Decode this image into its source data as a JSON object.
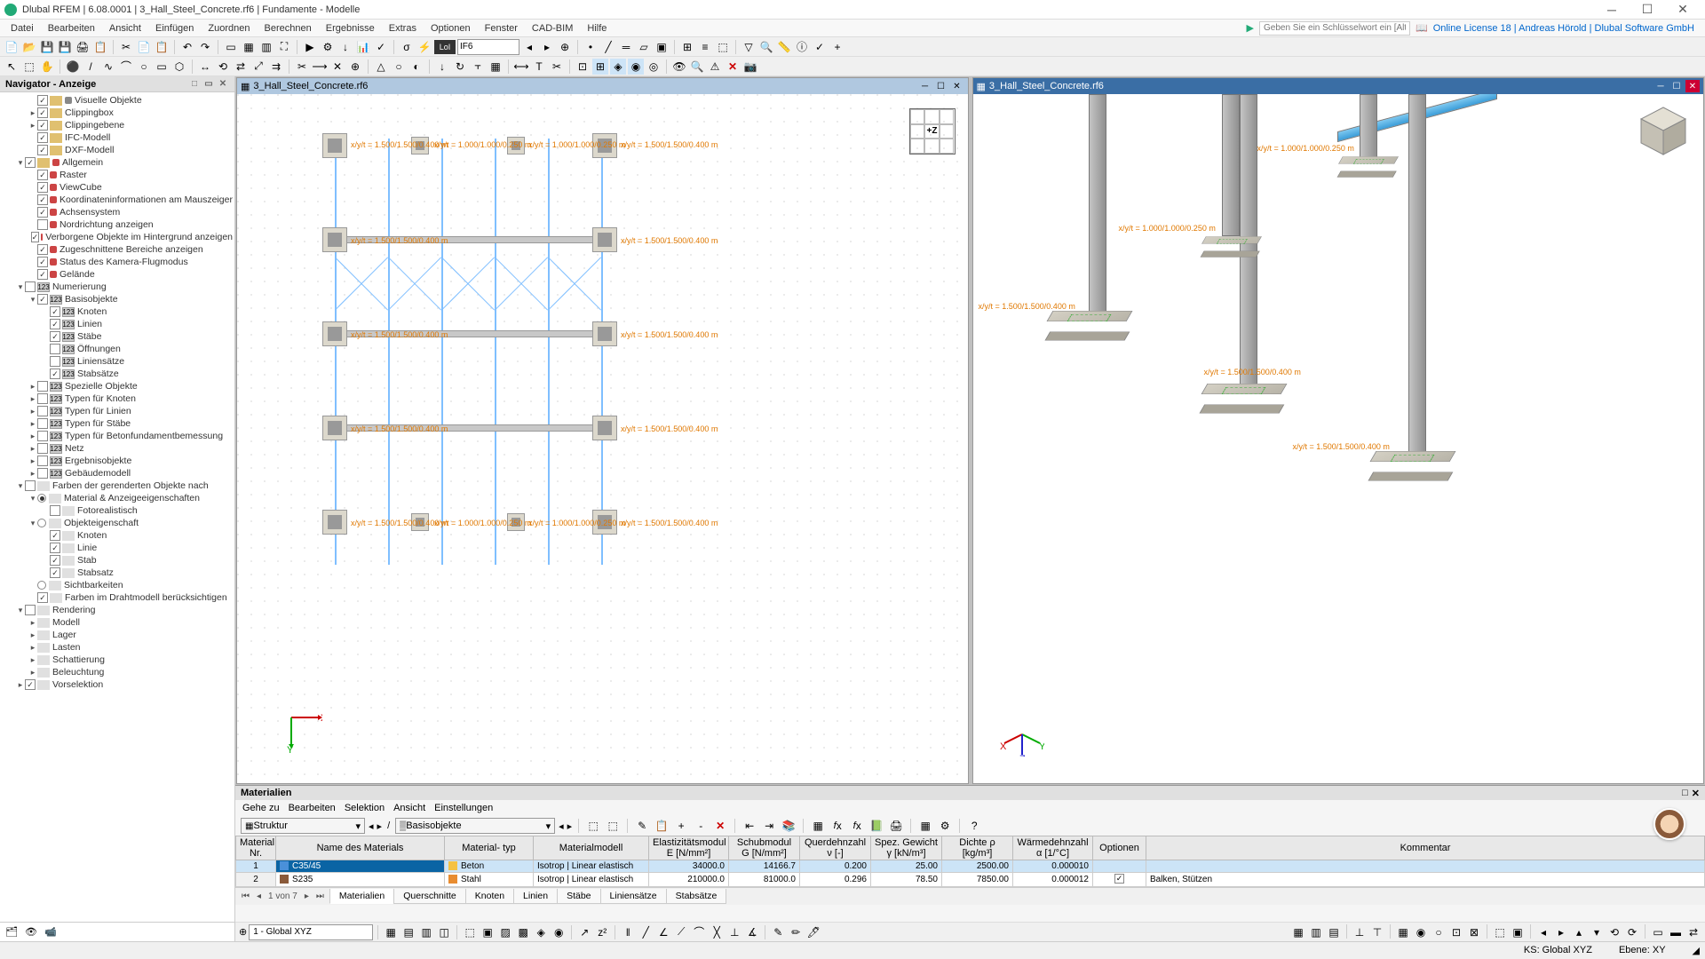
{
  "title": "Dlubal RFEM | 6.08.0001 | 3_Hall_Steel_Concrete.rf6 | Fundamente - Modelle",
  "menu": [
    "Datei",
    "Bearbeiten",
    "Ansicht",
    "Einfügen",
    "Zuordnen",
    "Berechnen",
    "Ergebnisse",
    "Extras",
    "Optionen",
    "Fenster",
    "CAD-BIM",
    "Hilfe"
  ],
  "key_placeholder": "Geben Sie ein Schlüsselwort ein [Alt...",
  "online": "Online License 18 | Andreas Hörold | Dlubal Software GmbH",
  "toolbar_combo": "IF6",
  "toolbar_badge": "LoI",
  "navigator": {
    "title": "Navigator - Anzeige",
    "items": [
      {
        "lvl": 2,
        "chk": true,
        "ico": "folder",
        "dotc": "#888",
        "label": "Visuelle Objekte"
      },
      {
        "lvl": 2,
        "toggle": "▸",
        "chk": true,
        "ico": "folder",
        "label": "Clippingbox"
      },
      {
        "lvl": 2,
        "toggle": "▸",
        "chk": true,
        "ico": "folder",
        "label": "Clippingebene"
      },
      {
        "lvl": 2,
        "chk": true,
        "ico": "folder",
        "label": "IFC-Modell"
      },
      {
        "lvl": 2,
        "chk": true,
        "ico": "folder",
        "label": "DXF-Modell"
      },
      {
        "lvl": 1,
        "toggle": "▾",
        "chk": true,
        "ico": "folder",
        "dotc": "#cc4444",
        "label": "Allgemein"
      },
      {
        "lvl": 2,
        "chk": true,
        "dotc": "#cc4444",
        "label": "Raster"
      },
      {
        "lvl": 2,
        "chk": true,
        "dotc": "#cc4444",
        "label": "ViewCube"
      },
      {
        "lvl": 2,
        "chk": true,
        "dotc": "#cc4444",
        "label": "Koordinateninformationen am Mauszeiger"
      },
      {
        "lvl": 2,
        "chk": true,
        "dotc": "#cc4444",
        "label": "Achsensystem"
      },
      {
        "lvl": 2,
        "chk": false,
        "dotc": "#cc4444",
        "label": "Nordrichtung anzeigen"
      },
      {
        "lvl": 2,
        "chk": true,
        "dotc": "#cc4444",
        "label": "Verborgene Objekte im Hintergrund anzeigen"
      },
      {
        "lvl": 2,
        "chk": true,
        "dotc": "#cc4444",
        "label": "Zugeschnittene Bereiche anzeigen"
      },
      {
        "lvl": 2,
        "chk": true,
        "dotc": "#cc4444",
        "label": "Status des Kamera-Flugmodus"
      },
      {
        "lvl": 2,
        "chk": true,
        "dotc": "#cc4444",
        "label": "Gelände"
      },
      {
        "lvl": 1,
        "toggle": "▾",
        "chk": false,
        "badge": "num",
        "label": "Numerierung"
      },
      {
        "lvl": 2,
        "toggle": "▾",
        "chk": true,
        "badge": "num",
        "label": "Basisobjekte"
      },
      {
        "lvl": 3,
        "chk": true,
        "badge": "num",
        "label": "Knoten"
      },
      {
        "lvl": 3,
        "chk": true,
        "badge": "num",
        "label": "Linien"
      },
      {
        "lvl": 3,
        "chk": true,
        "badge": "num",
        "label": "Stäbe"
      },
      {
        "lvl": 3,
        "chk": false,
        "badge": "num",
        "label": "Öffnungen"
      },
      {
        "lvl": 3,
        "chk": false,
        "badge": "num",
        "label": "Liniensätze"
      },
      {
        "lvl": 3,
        "chk": true,
        "badge": "num",
        "label": "Stabsätze"
      },
      {
        "lvl": 2,
        "toggle": "▸",
        "chk": false,
        "badge": "num",
        "label": "Spezielle Objekte"
      },
      {
        "lvl": 2,
        "toggle": "▸",
        "chk": false,
        "badge": "num",
        "label": "Typen für Knoten"
      },
      {
        "lvl": 2,
        "toggle": "▸",
        "chk": false,
        "badge": "num",
        "label": "Typen für Linien"
      },
      {
        "lvl": 2,
        "toggle": "▸",
        "chk": false,
        "badge": "num",
        "label": "Typen für Stäbe"
      },
      {
        "lvl": 2,
        "toggle": "▸",
        "chk": false,
        "badge": "num",
        "label": "Typen für Betonfundamentbemessung"
      },
      {
        "lvl": 2,
        "toggle": "▸",
        "chk": false,
        "badge": "num",
        "label": "Netz"
      },
      {
        "lvl": 2,
        "toggle": "▸",
        "chk": false,
        "badge": "num",
        "label": "Ergebnisobjekte"
      },
      {
        "lvl": 2,
        "toggle": "▸",
        "chk": false,
        "badge": "num",
        "label": "Gebäudemodell"
      },
      {
        "lvl": 1,
        "toggle": "▾",
        "chk": false,
        "badge": "col",
        "label": "Farben der gerenderten Objekte nach"
      },
      {
        "lvl": 2,
        "toggle": "▾",
        "radio": "on",
        "badge": "col",
        "label": "Material & Anzeigeeigenschaften"
      },
      {
        "lvl": 3,
        "chk": false,
        "badge": "col",
        "label": "Fotorealistisch"
      },
      {
        "lvl": 2,
        "toggle": "▾",
        "radio": "off",
        "badge": "col",
        "label": "Objekteigenschaft"
      },
      {
        "lvl": 3,
        "chk": true,
        "badge": "col",
        "label": "Knoten"
      },
      {
        "lvl": 3,
        "chk": true,
        "badge": "col",
        "label": "Linie"
      },
      {
        "lvl": 3,
        "chk": true,
        "badge": "col",
        "label": "Stab"
      },
      {
        "lvl": 3,
        "chk": true,
        "badge": "col",
        "label": "Stabsatz"
      },
      {
        "lvl": 2,
        "radio": "off",
        "badge": "col",
        "label": "Sichtbarkeiten"
      },
      {
        "lvl": 2,
        "chk": true,
        "badge": "col",
        "label": "Farben im Drahtmodell berücksichtigen"
      },
      {
        "lvl": 1,
        "toggle": "▾",
        "chk": false,
        "badge": "col",
        "label": "Rendering"
      },
      {
        "lvl": 2,
        "toggle": "▸",
        "badge": "col",
        "label": "Modell"
      },
      {
        "lvl": 2,
        "toggle": "▸",
        "badge": "col",
        "label": "Lager"
      },
      {
        "lvl": 2,
        "toggle": "▸",
        "badge": "col",
        "label": "Lasten"
      },
      {
        "lvl": 2,
        "toggle": "▸",
        "badge": "col",
        "label": "Schattierung"
      },
      {
        "lvl": 2,
        "toggle": "▸",
        "badge": "col",
        "label": "Beleuchtung"
      },
      {
        "lvl": 1,
        "toggle": "▸",
        "chk": true,
        "badge": "col",
        "label": "Vorselektion"
      }
    ]
  },
  "viewport_title": "3_Hall_Steel_Concrete.rf6",
  "dims": {
    "a": "x/y/t = 1.500/1.500/0.400 m",
    "b": "x/y/t = 1.000/1.000/0.250 m",
    "c": "x/y/t = 1.000/1.000/0.250 m",
    "d": "x/y/t = 1.500/1.500/0.400 m"
  },
  "viewcube_center": "+Z",
  "materials": {
    "title": "Materialien",
    "menu": [
      "Gehe zu",
      "Bearbeiten",
      "Selektion",
      "Ansicht",
      "Einstellungen"
    ],
    "combo1": "Struktur",
    "combo2": "Basisobjekte",
    "headers": {
      "nr": "Material\nNr.",
      "name": "Name des Materials",
      "type": "Material-\ntyp",
      "model": "Materialmodell",
      "e": "Elastizitätsmodul\nE [N/mm²]",
      "g": "Schubmodul\nG [N/mm²]",
      "nu": "Querdehnzahl\nν [-]",
      "gamma": "Spez. Gewicht\nγ [kN/m³]",
      "rho": "Dichte\nρ [kg/m³]",
      "alpha": "Wärmedehnzahl\nα [1/°C]",
      "opt": "Optionen",
      "comment": "Kommentar"
    },
    "rows": [
      {
        "nr": "1",
        "swatch": "#4a90d9",
        "name": "C35/45",
        "typeswatch": "#f5c242",
        "type": "Beton",
        "model": "Isotrop | Linear elastisch",
        "e": "34000.0",
        "g": "14166.7",
        "nu": "0.200",
        "gamma": "25.00",
        "rho": "2500.00",
        "alpha": "0.000010",
        "opt": "",
        "comment": ""
      },
      {
        "nr": "2",
        "swatch": "#8a5a3a",
        "name": "S235",
        "typeswatch": "#e88c30",
        "type": "Stahl",
        "model": "Isotrop | Linear elastisch",
        "e": "210000.0",
        "g": "81000.0",
        "nu": "0.296",
        "gamma": "78.50",
        "rho": "7850.00",
        "alpha": "0.000012",
        "opt": "☑",
        "comment": "Balken, Stützen"
      }
    ],
    "page": "1 von 7",
    "tabs": [
      "Materialien",
      "Querschnitte",
      "Knoten",
      "Linien",
      "Stäbe",
      "Liniensätze",
      "Stabsätze"
    ]
  },
  "bottom_combo": "1 - Global XYZ",
  "status": {
    "ks": "KS: Global XYZ",
    "ebene": "Ebene: XY"
  }
}
